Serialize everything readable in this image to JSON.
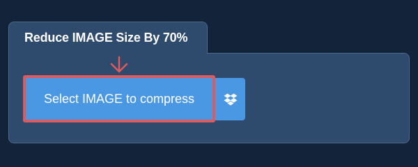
{
  "card": {
    "title": "Reduce IMAGE Size By 70%"
  },
  "upload": {
    "select_label": "Select IMAGE to compress",
    "dropbox_icon": "dropbox-icon",
    "pointer_icon": "arrow-down-icon"
  },
  "colors": {
    "page_background": "#13233a",
    "card_background": "#2e4b6d",
    "button_blue": "#4a97e3",
    "highlight_red": "#db5b5e"
  }
}
